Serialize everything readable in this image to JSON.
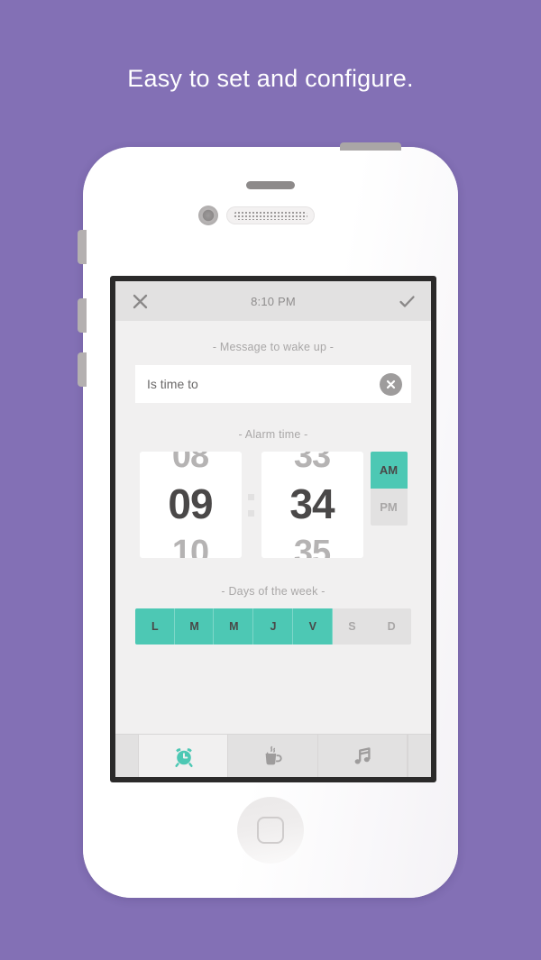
{
  "headline": "Easy to set and configure.",
  "colors": {
    "background_purple": "#8370b5",
    "accent_teal": "#4dc8b4",
    "screen_bg": "#f1f0f0",
    "bar_gray": "#e2e1e1",
    "text_dark": "#4a4848",
    "text_muted": "#a9a7a7"
  },
  "appbar": {
    "close_icon": "close-icon",
    "title": "8:10 PM",
    "confirm_icon": "check-icon"
  },
  "message": {
    "label": "- Message to wake up -",
    "value": "Is time to",
    "placeholder": "Is time to",
    "clear_icon": "clear-circle-icon"
  },
  "alarm_time": {
    "label": "- Alarm time -",
    "hour": {
      "prev": "08",
      "current": "09",
      "next": "10"
    },
    "minute": {
      "prev": "33",
      "current": "34",
      "next": "35"
    },
    "meridiem": {
      "selected": "AM",
      "options": [
        {
          "label": "AM",
          "selected": true
        },
        {
          "label": "PM",
          "selected": false
        }
      ]
    }
  },
  "days": {
    "label": "- Days of the week -",
    "items": [
      {
        "label": "L",
        "selected": true
      },
      {
        "label": "M",
        "selected": true
      },
      {
        "label": "M",
        "selected": true
      },
      {
        "label": "J",
        "selected": true
      },
      {
        "label": "V",
        "selected": true
      },
      {
        "label": "S",
        "selected": false
      },
      {
        "label": "D",
        "selected": false
      }
    ]
  },
  "tabs": [
    {
      "icon": "alarm-clock-icon",
      "active": true
    },
    {
      "icon": "coffee-cup-icon",
      "active": false
    },
    {
      "icon": "music-note-icon",
      "active": false
    }
  ]
}
